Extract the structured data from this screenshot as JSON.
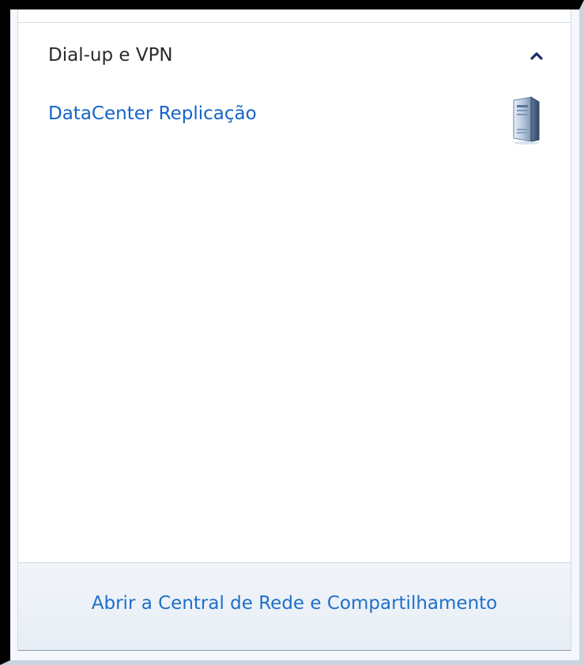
{
  "section": {
    "title": "Dial-up e VPN",
    "collapse_icon": "chevron-up-icon"
  },
  "connections": [
    {
      "name": "DataCenter Replicação",
      "icon": "server-icon"
    }
  ],
  "footer": {
    "link_label": "Abrir a Central de Rede e Compartilhamento"
  },
  "colors": {
    "link": "#1464c8",
    "header_text": "#2a2a2a",
    "footer_bg": "#eef3f9"
  }
}
